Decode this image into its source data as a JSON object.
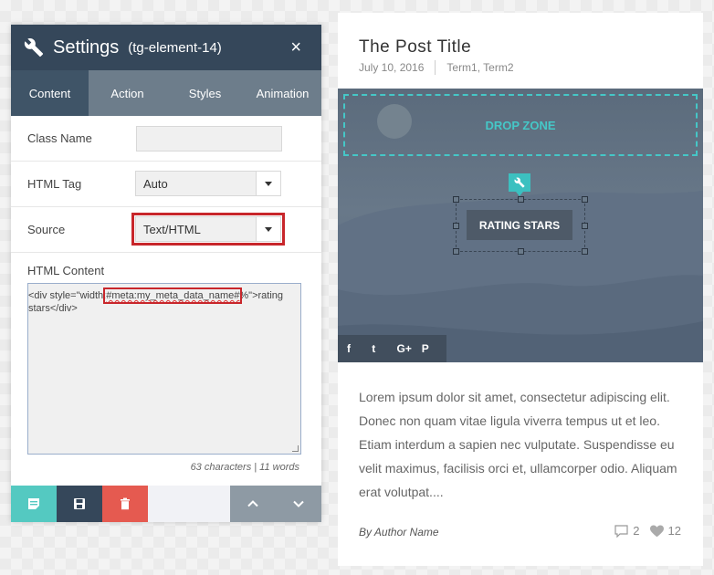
{
  "settings_panel": {
    "title": "Settings",
    "element_id": "(tg-element-14)",
    "close_symbol": "×",
    "tabs": [
      {
        "label": "Content",
        "active": true
      },
      {
        "label": "Action",
        "active": false
      },
      {
        "label": "Styles",
        "active": false
      },
      {
        "label": "Animation",
        "active": false
      }
    ],
    "fields": {
      "class_name": {
        "label": "Class Name",
        "value": ""
      },
      "html_tag": {
        "label": "HTML Tag",
        "value": "Auto"
      },
      "source": {
        "label": "Source",
        "value": "Text/HTML"
      },
      "html_content": {
        "label": "HTML Content",
        "code_before": "<div style=\"width:",
        "code_highlight": "#meta:my_meta_data_name#",
        "code_after": "%\">rating stars</div>",
        "counter": "63 characters | 11 words"
      }
    },
    "action_icons": [
      "note-icon",
      "save-icon",
      "trash-icon",
      "chevron-up-icon",
      "chevron-down-icon"
    ],
    "colors": {
      "header": "#35475a",
      "active_tab": "#3f5467",
      "tabs": "#6d7d8b",
      "teal": "#54c9c1",
      "red": "#e55a50",
      "highlight": "#c8262b"
    }
  },
  "post": {
    "title": "The Post Title",
    "date": "July 10, 2016",
    "terms": "Term1, Term2",
    "drop_zone": "DROP ZONE",
    "rating_button": "RATING STARS",
    "social": [
      "f",
      "t",
      "G+",
      "P"
    ],
    "excerpt": "Lorem ipsum dolor sit amet, consectetur adipiscing elit. Donec non quam vitae ligula viverra tempus ut et leo. Etiam interdum a sapien nec vulputate. Suspendisse eu velit maximus, facilisis orci et, ullamcorper odio. Aliquam erat volutpat....",
    "author": "By Author Name",
    "comments": "2",
    "likes": "12",
    "colors": {
      "accent": "#45c7c7"
    }
  }
}
